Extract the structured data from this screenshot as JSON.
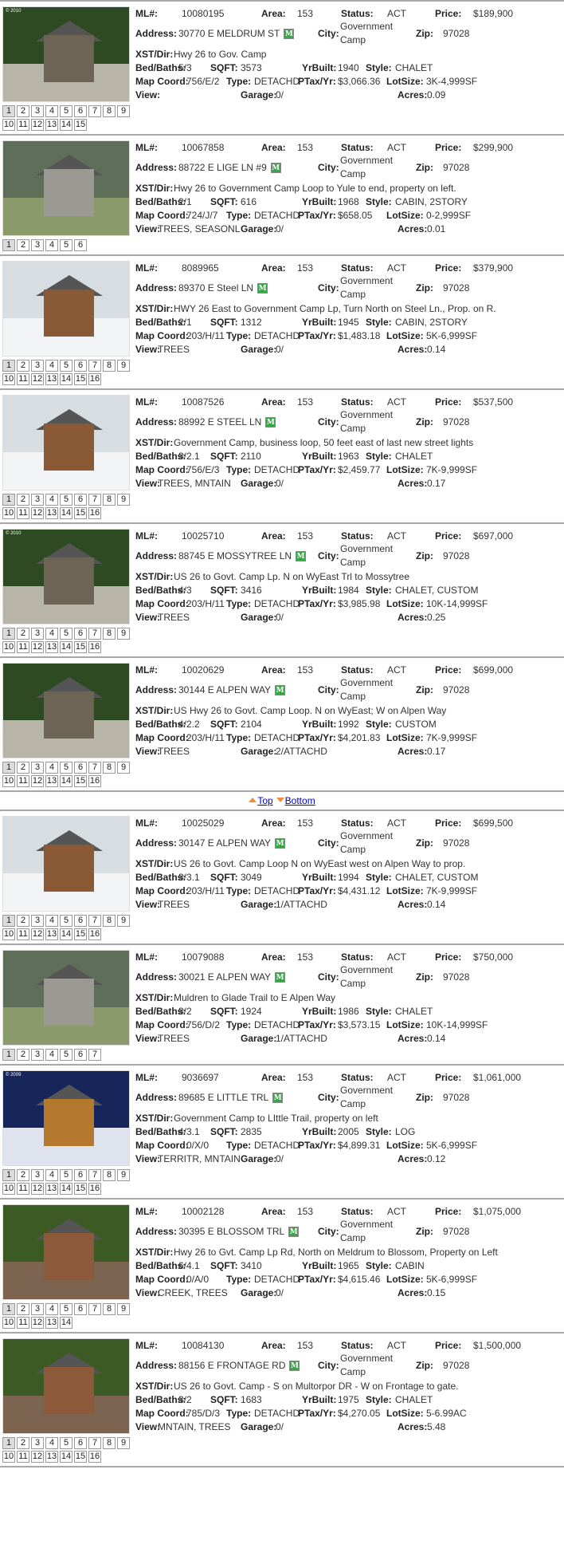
{
  "labels": {
    "ml": "ML#:",
    "area": "Area:",
    "status": "Status:",
    "price": "Price:",
    "address": "Address:",
    "city": "City:",
    "zip": "Zip:",
    "xst": "XST/Dir:",
    "bedbaths": "Bed/Baths:",
    "sqft": "SQFT:",
    "yrbuilt": "YrBuilt:",
    "style": "Style:",
    "mapcoord": "Map Coord:",
    "type": "Type:",
    "ptax": "PTax/Yr:",
    "lotsize": "LotSize:",
    "view": "View:",
    "garage": "Garage:",
    "acres": "Acres:",
    "mls_badge": "M"
  },
  "nav": {
    "top_label": "Top",
    "bottom_label": "Bottom",
    "after_listing_index": 5
  },
  "listings": [
    {
      "ml": "10080195",
      "area": "153",
      "status": "ACT",
      "price": "$189,900",
      "address": "30770 E MELDRUM ST",
      "city": "Government Camp",
      "zip": "97028",
      "xst": "Hwy 26 to Gov. Camp",
      "bedbaths": "5/3",
      "sqft": "3573",
      "yrbuilt": "1940",
      "style": "CHALET",
      "mapcoord": "756/E/2",
      "type": "DETACHD",
      "ptax": "$3,066.36",
      "lotsize": "3K-4,999SF",
      "view": "",
      "garage": "0/",
      "acres": "0.09",
      "photo_count": 15,
      "photo_theme": "forest",
      "photo_copyright": "© 2010"
    },
    {
      "ml": "10067858",
      "area": "153",
      "status": "ACT",
      "price": "$299,900",
      "address": "88722 E LIGE LN #9",
      "city": "Government Camp",
      "zip": "97028",
      "xst": "Hwy 26 to Government Camp Loop to Yule to end, property on left.",
      "bedbaths": "2/1",
      "sqft": "616",
      "yrbuilt": "1968",
      "style": "CABIN, 2STORY",
      "mapcoord": "724/J/7",
      "type": "DETACHD",
      "ptax": "$658.05",
      "lotsize": "0-2,999SF",
      "view": "TREES, SEASONL",
      "garage": "0/",
      "acres": "0.01",
      "photo_count": 6,
      "photo_theme": "grey",
      "photo_copyright": ""
    },
    {
      "ml": "8089965",
      "area": "153",
      "status": "ACT",
      "price": "$379,900",
      "address": "89370 E Steel LN",
      "city": "Government Camp",
      "zip": "97028",
      "xst": "HWY 26 East to Government Camp Lp, Turn North on Steel Ln., Prop. on R.",
      "bedbaths": "2/1",
      "sqft": "1312",
      "yrbuilt": "1945",
      "style": "CABIN, 2STORY",
      "mapcoord": "203/H/11",
      "type": "DETACHD",
      "ptax": "$1,483.18",
      "lotsize": "5K-6,999SF",
      "view": "TREES",
      "garage": "0/",
      "acres": "0.14",
      "photo_count": 16,
      "photo_theme": "snow",
      "photo_copyright": ""
    },
    {
      "ml": "10087526",
      "area": "153",
      "status": "ACT",
      "price": "$537,500",
      "address": "88992 E STEEL LN",
      "city": "Government Camp",
      "zip": "97028",
      "xst": "Government Camp, business loop, 50 feet east of last new street lights",
      "bedbaths": "3/2.1",
      "sqft": "2110",
      "yrbuilt": "1963",
      "style": "CHALET",
      "mapcoord": "756/E/3",
      "type": "DETACHD",
      "ptax": "$2,459.77",
      "lotsize": "7K-9,999SF",
      "view": "TREES, MNTAIN",
      "garage": "0/",
      "acres": "0.17",
      "photo_count": 16,
      "photo_theme": "snow",
      "photo_copyright": ""
    },
    {
      "ml": "10025710",
      "area": "153",
      "status": "ACT",
      "price": "$697,000",
      "address": "88745 E MOSSYTREE LN",
      "city": "Government Camp",
      "zip": "97028",
      "xst": "US 26 to Govt. Camp Lp. N on WyEast Trl to Mossytree",
      "bedbaths": "4/3",
      "sqft": "3416",
      "yrbuilt": "1984",
      "style": "CHALET, CUSTOM",
      "mapcoord": "203/H/11",
      "type": "DETACHD",
      "ptax": "$3,985.98",
      "lotsize": "10K-14,999SF",
      "view": "TREES",
      "garage": "0/",
      "acres": "0.25",
      "photo_count": 16,
      "photo_theme": "forest",
      "photo_copyright": "© 2010"
    },
    {
      "ml": "10020629",
      "area": "153",
      "status": "ACT",
      "price": "$699,000",
      "address": "30144 E ALPEN WAY",
      "city": "Government Camp",
      "zip": "97028",
      "xst": "US Hwy 26 to Govt. Camp Loop. N on WyEast; W on Alpen Way",
      "bedbaths": "4/2.2",
      "sqft": "2104",
      "yrbuilt": "1992",
      "style": "CUSTOM",
      "mapcoord": "203/H/11",
      "type": "DETACHD",
      "ptax": "$4,201.83",
      "lotsize": "7K-9,999SF",
      "view": "TREES",
      "garage": "2/ATTACHD",
      "acres": "0.17",
      "photo_count": 16,
      "photo_theme": "forest",
      "photo_copyright": ""
    },
    {
      "ml": "10025029",
      "area": "153",
      "status": "ACT",
      "price": "$699,500",
      "address": "30147 E ALPEN WAY",
      "city": "Government Camp",
      "zip": "97028",
      "xst": "US 26 to Govt. Camp Loop N on WyEast west on Alpen Way to prop.",
      "bedbaths": "3/3.1",
      "sqft": "3049",
      "yrbuilt": "1994",
      "style": "CHALET, CUSTOM",
      "mapcoord": "203/H/11",
      "type": "DETACHD",
      "ptax": "$4,431.12",
      "lotsize": "7K-9,999SF",
      "view": "TREES",
      "garage": "1/ATTACHD",
      "acres": "0.14",
      "photo_count": 16,
      "photo_theme": "snow",
      "photo_copyright": ""
    },
    {
      "ml": "10079088",
      "area": "153",
      "status": "ACT",
      "price": "$750,000",
      "address": "30021 E ALPEN WAY",
      "city": "Government Camp",
      "zip": "97028",
      "xst": "Muldren to Glade Trail to E Alpen Way",
      "bedbaths": "3/2",
      "sqft": "1924",
      "yrbuilt": "1986",
      "style": "CHALET",
      "mapcoord": "756/D/2",
      "type": "DETACHD",
      "ptax": "$3,573.15",
      "lotsize": "10K-14,999SF",
      "view": "TREES",
      "garage": "1/ATTACHD",
      "acres": "0.14",
      "photo_count": 7,
      "photo_theme": "grey",
      "photo_copyright": ""
    },
    {
      "ml": "9036697",
      "area": "153",
      "status": "ACT",
      "price": "$1,061,000",
      "address": "89685 E LITTLE TRL",
      "city": "Government Camp",
      "zip": "97028",
      "xst": "Government Camp to LIttle Trail, property on left",
      "bedbaths": "4/3.1",
      "sqft": "2835",
      "yrbuilt": "2005",
      "style": "LOG",
      "mapcoord": "0/X/0",
      "type": "DETACHD",
      "ptax": "$4,899.31",
      "lotsize": "5K-6,999SF",
      "view": "TERRITR, MNTAIN",
      "garage": "0/",
      "acres": "0.12",
      "photo_count": 16,
      "photo_theme": "night",
      "photo_copyright": "© 2009"
    },
    {
      "ml": "10002128",
      "area": "153",
      "status": "ACT",
      "price": "$1,075,000",
      "address": "30395 E BLOSSOM TRL",
      "city": "Government Camp",
      "zip": "97028",
      "xst": "Hwy 26 to Gvt. Camp Lp Rd, North on Meldrum to Blossom, Property on Left",
      "bedbaths": "6/4.1",
      "sqft": "3410",
      "yrbuilt": "1965",
      "style": "CABIN",
      "mapcoord": "0/A/0",
      "type": "DETACHD",
      "ptax": "$4,615.46",
      "lotsize": "5K-6,999SF",
      "view": "CREEK, TREES",
      "garage": "0/",
      "acres": "0.15",
      "photo_count": 14,
      "photo_theme": "wood",
      "photo_copyright": ""
    },
    {
      "ml": "10084130",
      "area": "153",
      "status": "ACT",
      "price": "$1,500,000",
      "address": "88156 E FRONTAGE RD",
      "city": "Government Camp",
      "zip": "97028",
      "xst": "US 26 to Govt. Camp - S on Multorpor DR - W on Frontage to gate.",
      "bedbaths": "3/2",
      "sqft": "1683",
      "yrbuilt": "1975",
      "style": "CHALET",
      "mapcoord": "785/D/3",
      "type": "DETACHD",
      "ptax": "$4,270.05",
      "lotsize": "5-6.99AC",
      "view": "MNTAIN, TREES",
      "garage": "0/",
      "acres": "5.48",
      "photo_count": 16,
      "photo_theme": "wood",
      "photo_copyright": ""
    }
  ],
  "themes": {
    "forest": {
      "sky": "#2e4a22",
      "ground": "#b9b4a8",
      "house": "#6e6456"
    },
    "grey": {
      "sky": "#5f6e58",
      "ground": "#8a9a6a",
      "house": "#9a9a92"
    },
    "snow": {
      "sky": "#d7dde0",
      "ground": "#f2f4f5",
      "house": "#8a5a36"
    },
    "night": {
      "sky": "#16265a",
      "ground": "#dfe3ee",
      "house": "#b4782e"
    },
    "wood": {
      "sky": "#3b5a24",
      "ground": "#7d6450",
      "house": "#8c5a3a"
    }
  }
}
